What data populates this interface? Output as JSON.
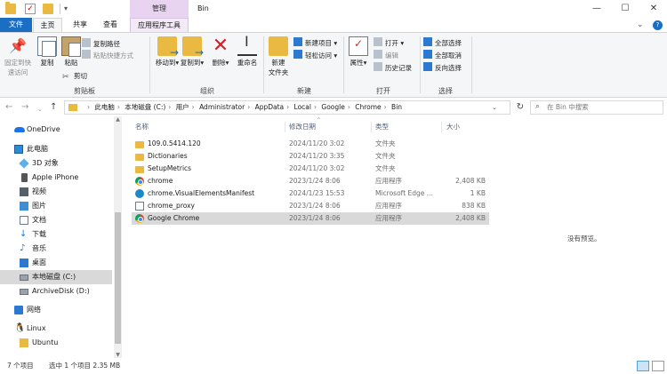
{
  "window": {
    "title": "Bin",
    "context_tab_header": "管理",
    "controls": {
      "minimize": "—",
      "maximize": "☐",
      "close": "✕"
    }
  },
  "ribbon_tabs": {
    "file": "文件",
    "home": "主页",
    "share": "共享",
    "view": "查看",
    "app_tools": "应用程序工具"
  },
  "ribbon": {
    "clipboard": {
      "label": "剪贴板",
      "pin": "固定到快\n速访问",
      "copy": "复制",
      "paste": "粘贴",
      "copy_path": "复制路径",
      "paste_shortcut": "粘贴快捷方式",
      "cut": "剪切"
    },
    "organize": {
      "label": "组织",
      "move_to": "移动到",
      "copy_to": "复制到",
      "delete": "删除",
      "rename": "重命名"
    },
    "new": {
      "label": "新建",
      "new_folder": "新建\n文件夹",
      "new_item": "新建项目",
      "easy_access": "轻松访问"
    },
    "open": {
      "label": "打开",
      "properties": "属性",
      "open": "打开",
      "edit": "编辑",
      "history": "历史记录"
    },
    "select": {
      "label": "选择",
      "select_all": "全部选择",
      "select_none": "全部取消",
      "invert": "反向选择"
    }
  },
  "address": {
    "crumbs": [
      "此电脑",
      "本地磁盘 (C:)",
      "用户",
      "Administrator",
      "AppData",
      "Local",
      "Google",
      "Chrome",
      "Bin"
    ],
    "search_placeholder": "在 Bin 中搜索"
  },
  "nav": {
    "items": [
      {
        "label": "OneDrive"
      },
      {
        "label": "此电脑"
      },
      {
        "label": "3D 对象"
      },
      {
        "label": "Apple iPhone"
      },
      {
        "label": "视频"
      },
      {
        "label": "图片"
      },
      {
        "label": "文档"
      },
      {
        "label": "下载"
      },
      {
        "label": "音乐"
      },
      {
        "label": "桌面"
      },
      {
        "label": "本地磁盘 (C:)"
      },
      {
        "label": "ArchiveDisk (D:)"
      },
      {
        "label": "网络"
      },
      {
        "label": "Linux"
      },
      {
        "label": "Ubuntu"
      }
    ]
  },
  "columns": {
    "name": "名称",
    "date": "修改日期",
    "type": "类型",
    "size": "大小"
  },
  "files": [
    {
      "name": "109.0.5414.120",
      "date": "2024/11/20 3:02",
      "type": "文件夹",
      "size": "",
      "icon": "folder"
    },
    {
      "name": "Dictionaries",
      "date": "2024/11/20 3:35",
      "type": "文件夹",
      "size": "",
      "icon": "folder"
    },
    {
      "name": "SetupMetrics",
      "date": "2024/11/20 3:02",
      "type": "文件夹",
      "size": "",
      "icon": "folder"
    },
    {
      "name": "chrome",
      "date": "2023/1/24 8:06",
      "type": "应用程序",
      "size": "2,408 KB",
      "icon": "chrome"
    },
    {
      "name": "chrome.VisualElementsManifest",
      "date": "2024/1/23 15:53",
      "type": "Microsoft Edge ...",
      "size": "1 KB",
      "icon": "edge"
    },
    {
      "name": "chrome_proxy",
      "date": "2023/1/24 8:06",
      "type": "应用程序",
      "size": "838 KB",
      "icon": "exe"
    },
    {
      "name": "Google Chrome",
      "date": "2023/1/24 8:06",
      "type": "应用程序",
      "size": "2,408 KB",
      "icon": "chrome"
    }
  ],
  "preview": {
    "text": "没有预览。"
  },
  "status": {
    "count": "7 个项目",
    "selection": "选中 1 个项目  2.35 MB"
  },
  "colors": {
    "accent": "#1a6fc4",
    "context_tab": "#e8d3f1",
    "selected_row": "#d9d9d9",
    "folder": "#e9b941"
  }
}
